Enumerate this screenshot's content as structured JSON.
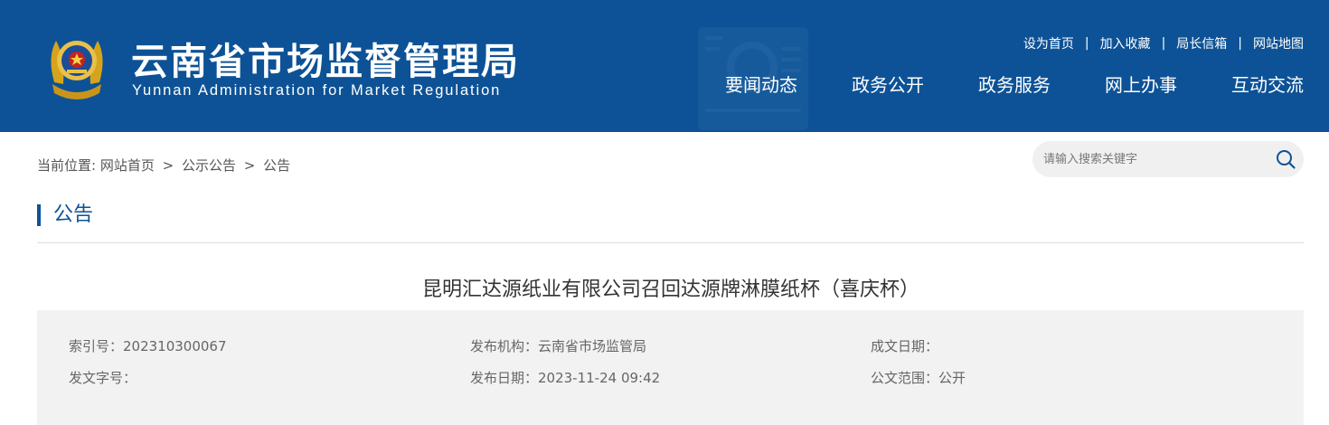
{
  "header": {
    "site_title": "云南省市场监督管理局",
    "site_subtitle": "Yunnan Administration for Market Regulation",
    "top_links": [
      "设为首页",
      "加入收藏",
      "局长信箱",
      "网站地图"
    ],
    "top_link_separator": "|",
    "nav_items": [
      "要闻动态",
      "政务公开",
      "政务服务",
      "网上办事",
      "互动交流"
    ],
    "colors": {
      "background": "#0d5296",
      "text": "#ffffff"
    }
  },
  "breadcrumb": {
    "prefix": "当前位置:",
    "items": [
      "网站首页",
      "公示公告",
      "公告"
    ],
    "separator": ">"
  },
  "search": {
    "placeholder": "请输入搜索关键字",
    "value": "",
    "icon": "search-icon"
  },
  "section": {
    "title": "公告"
  },
  "article": {
    "title": "昆明汇达源纸业有限公司召回达源牌淋膜纸杯（喜庆杯）"
  },
  "meta": {
    "index_no": "索引号：202310300067",
    "publisher": "发布机构：云南省市场监管局",
    "written_date": "成文日期：",
    "doc_no": "发文字号：",
    "publish_date": "发布日期：2023-11-24 09:42",
    "scope": "公文范围：公开"
  },
  "icons": {
    "emblem": "police-emblem-icon",
    "search": "search-icon"
  }
}
